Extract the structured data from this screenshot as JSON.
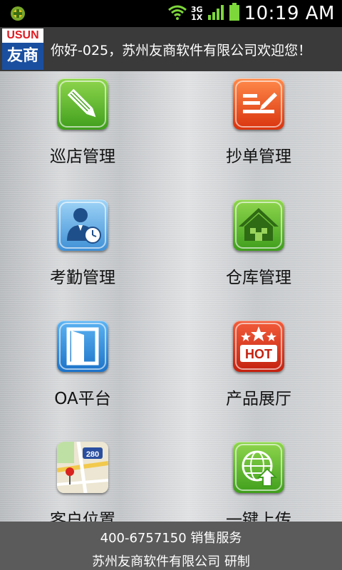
{
  "status_bar": {
    "time": "10:19 AM",
    "network_top": "3G",
    "network_bottom": "1X",
    "icons": [
      "app-notification-icon",
      "wifi-icon",
      "signal-icon",
      "battery-icon"
    ]
  },
  "header": {
    "logo_top": "USUN",
    "logo_bottom": "友商",
    "welcome": "你好-025，苏州友商软件有限公司欢迎您！"
  },
  "tiles": [
    {
      "label": "巡店管理",
      "icon": "pencil-icon",
      "color": "#5cb82c"
    },
    {
      "label": "抄单管理",
      "icon": "note-icon",
      "color": "#e5451d"
    },
    {
      "label": "考勤管理",
      "icon": "person-clock-icon",
      "color": "#3a8fd8"
    },
    {
      "label": "仓库管理",
      "icon": "house-icon",
      "color": "#5cb82c"
    },
    {
      "label": "OA平台",
      "icon": "door-icon",
      "color": "#2b86d6"
    },
    {
      "label": "产品展厅",
      "icon": "hot-stars-icon",
      "color": "#dd3b21"
    },
    {
      "label": "客户位置",
      "icon": "map-icon",
      "color": "#e8e2cf"
    },
    {
      "label": "一键上传",
      "icon": "globe-upload-icon",
      "color": "#5cb82c"
    }
  ],
  "map_badge": "280",
  "hot_text": "HOT",
  "footer": {
    "line1": "400-6757150 销售服务",
    "line2": "苏州友商软件有限公司 研制"
  }
}
